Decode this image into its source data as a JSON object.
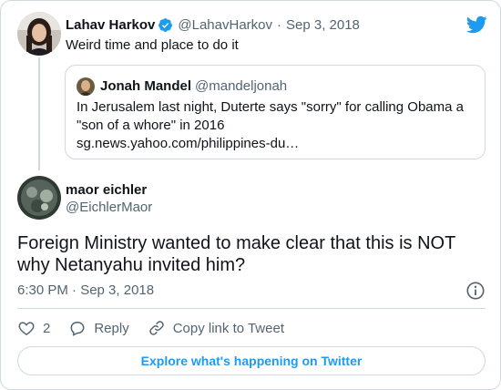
{
  "colors": {
    "accent": "#1d9bf0",
    "text": "#0f1419",
    "muted": "#536471",
    "border": "#cfd9de"
  },
  "parent": {
    "name": "Lahav Harkov",
    "handle": "@LahavHarkov",
    "separator": "·",
    "date": "Sep 3, 2018",
    "text": "Weird time and place to do it",
    "icons": {
      "verified": "verified-badge-icon",
      "brand": "twitter-bird-icon"
    }
  },
  "quote": {
    "name": "Jonah Mandel",
    "handle": "@mandeljonah",
    "text_line1": "In Jerusalem last night, Duterte says \"sorry\" for calling Obama a",
    "text_line2": "\"son of a whore\" in 2016",
    "link": "sg.news.yahoo.com/philippines-du…"
  },
  "reply": {
    "name": "maor eichler",
    "handle": "@EichlerMaor",
    "text_line1": "Foreign Ministry wanted to make clear that this is NOT",
    "text_line2": "why Netanyahu invited him?",
    "timestamp": "6:30 PM · Sep 3, 2018"
  },
  "actions": {
    "like_count": "2",
    "reply_label": "Reply",
    "copy_label": "Copy link to Tweet"
  },
  "explore_label": "Explore what's happening on Twitter"
}
